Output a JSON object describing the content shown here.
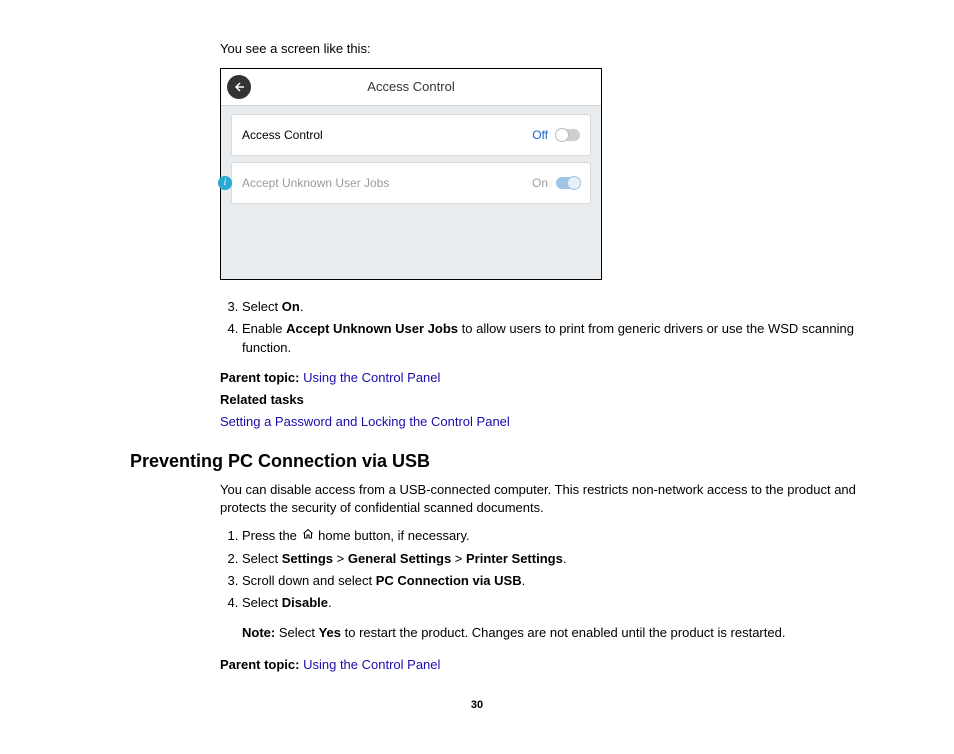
{
  "intro": "You see a screen like this:",
  "screenshot": {
    "title": "Access Control",
    "rows": [
      {
        "label": "Access Control",
        "value": "Off",
        "state": "off",
        "disabled": false
      },
      {
        "label": "Accept Unknown User Jobs",
        "value": "On",
        "state": "on",
        "disabled": true
      }
    ]
  },
  "steps_a": {
    "s3": {
      "prefix": "Select ",
      "bold": "On",
      "suffix": "."
    },
    "s4": {
      "prefix": "Enable ",
      "bold": "Accept Unknown User Jobs",
      "suffix": " to allow users to print from generic drivers or use the WSD scanning function."
    }
  },
  "parent_topic_label": "Parent topic:",
  "parent_topic_link": "Using the Control Panel",
  "related_tasks_label": "Related tasks",
  "related_tasks_link": "Setting a Password and Locking the Control Panel",
  "section_heading": "Preventing PC Connection via USB",
  "section_intro": "You can disable access from a USB-connected computer. This restricts non-network access to the product and protects the security of confidential scanned documents.",
  "steps_b": {
    "s1": {
      "pre": "Press the ",
      "post": " home button, if necessary."
    },
    "s2": {
      "pre": "Select ",
      "b1": "Settings",
      "gt1": " > ",
      "b2": "General Settings",
      "gt2": " > ",
      "b3": "Printer Settings",
      "post": "."
    },
    "s3": {
      "pre": "Scroll down and select ",
      "b1": "PC Connection via USB",
      "post": "."
    },
    "s4": {
      "pre": "Select ",
      "b1": "Disable",
      "post": "."
    }
  },
  "note": {
    "label": "Note:",
    "text": " Select ",
    "bold": "Yes",
    "suffix": " to restart the product. Changes are not enabled until the product is restarted."
  },
  "page_number": "30"
}
